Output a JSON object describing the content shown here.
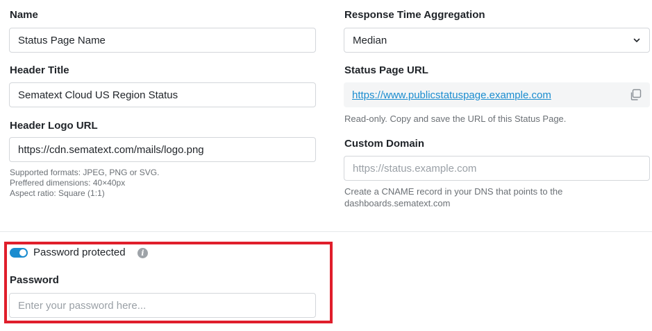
{
  "left": {
    "name": {
      "label": "Name",
      "value": "Status Page Name"
    },
    "header_title": {
      "label": "Header Title",
      "value": "Sematext Cloud US Region Status"
    },
    "header_logo": {
      "label": "Header Logo URL",
      "value": "https://cdn.sematext.com/mails/logo.png",
      "help": [
        "Supported formats: JPEG, PNG or SVG.",
        "Preffered dimensions: 40×40px",
        "Aspect ratio: Square (1:1)"
      ]
    }
  },
  "right": {
    "aggregation": {
      "label": "Response Time Aggregation",
      "value": "Median"
    },
    "status_url": {
      "label": "Status Page URL",
      "value": "https://www.publicstatuspage.example.com",
      "help": "Read-only. Copy and save the URL of this Status Page."
    },
    "custom_domain": {
      "label": "Custom Domain",
      "placeholder": "https://status.example.com",
      "help": [
        "Create a CNAME record in your DNS that points to the",
        "dashboards.sematext.com"
      ]
    }
  },
  "password_section": {
    "toggle_label": "Password protected",
    "toggle_on": true,
    "info_glyph": "i",
    "password_label": "Password",
    "password_placeholder": "Enter your password here..."
  },
  "colors": {
    "accent": "#1a8ccf",
    "highlight": "#e01e2b"
  },
  "icons": {
    "dropdown": "chevron-down-icon",
    "copy": "copy-icon",
    "info": "info-icon"
  }
}
